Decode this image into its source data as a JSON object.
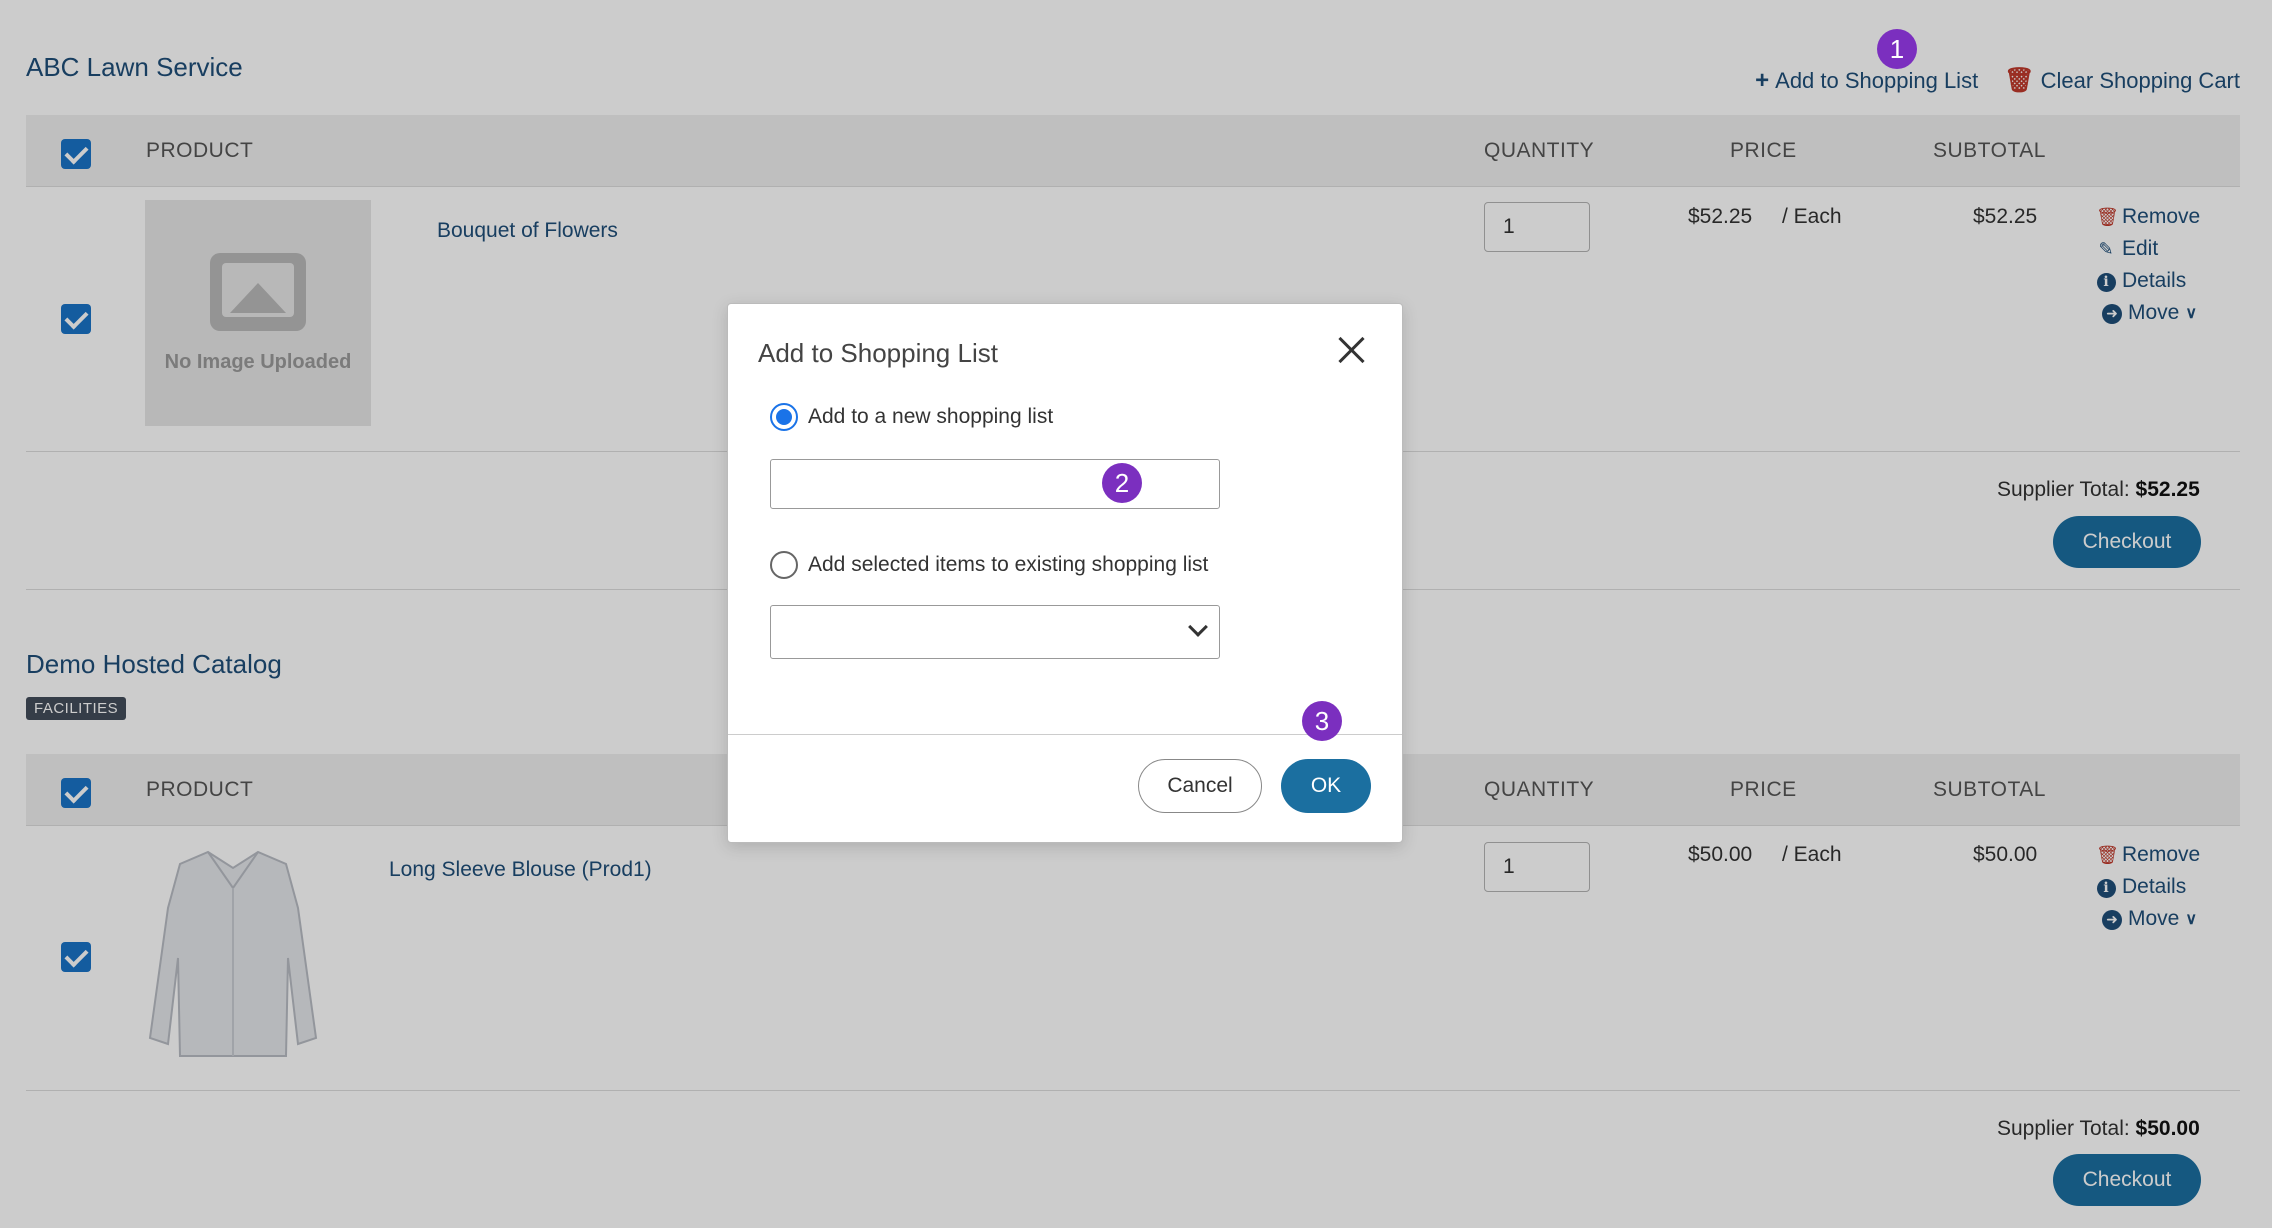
{
  "top_actions": {
    "add_to_list": "Add to Shopping List",
    "clear_cart": "Clear Shopping Cart"
  },
  "columns": {
    "product": "PRODUCT",
    "quantity": "QUANTITY",
    "price": "PRICE",
    "subtotal": "SUBTOTAL"
  },
  "suppliers": [
    {
      "name": "ABC Lawn Service",
      "item": {
        "name": "Bouquet of Flowers",
        "image_placeholder": "No Image Uploaded",
        "quantity": "1",
        "price": "$52.25",
        "unit": "/ Each",
        "subtotal": "$52.25",
        "actions": [
          "Remove",
          "Edit",
          "Details",
          "Move"
        ]
      },
      "total_label": "Supplier Total:",
      "total_value": "$52.25",
      "checkout": "Checkout"
    },
    {
      "name": "Demo Hosted Catalog",
      "badge": "FACILITIES",
      "item": {
        "name": "Long Sleeve Blouse (Prod1)",
        "quantity": "1",
        "price": "$50.00",
        "unit": "/ Each",
        "subtotal": "$50.00",
        "actions": [
          "Remove",
          "Details",
          "Move"
        ]
      },
      "total_label": "Supplier Total:",
      "total_value": "$50.00",
      "checkout": "Checkout"
    }
  ],
  "modal": {
    "title": "Add to Shopping List",
    "option_new": "Add to a new shopping list",
    "new_list_value": "",
    "option_existing": "Add selected items to existing shopping list",
    "existing_selected": "",
    "cancel": "Cancel",
    "ok": "OK"
  },
  "steps": [
    "1",
    "2",
    "3"
  ],
  "colors": {
    "accent": "#1b6fa0",
    "link": "#1f4e79",
    "danger": "#c0392b",
    "step_marker": "#7b2fbf",
    "overlay": "rgba(0,0,0,0.2)"
  }
}
